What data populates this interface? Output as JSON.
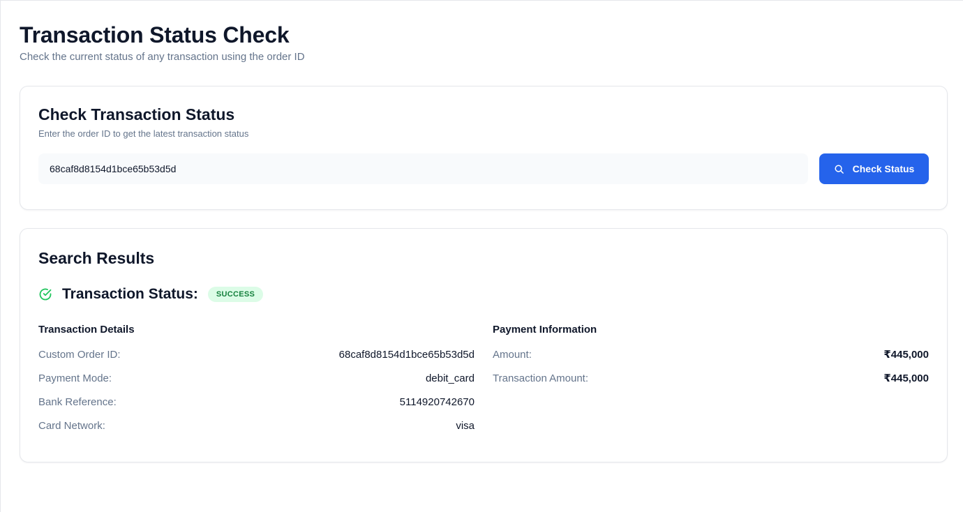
{
  "header": {
    "title": "Transaction Status Check",
    "subtitle": "Check the current status of any transaction using the order ID"
  },
  "search_card": {
    "title": "Check Transaction Status",
    "description": "Enter the order ID to get the latest transaction status",
    "order_id_value": "68caf8d8154d1bce65b53d5d",
    "button_label": "Check Status",
    "button_icon": "search-icon"
  },
  "results": {
    "title": "Search Results",
    "status_icon": "check-circle-icon",
    "status_label": "Transaction Status:",
    "status_badge": "SUCCESS",
    "transaction_details": {
      "title": "Transaction Details",
      "rows": [
        {
          "label": "Custom Order ID:",
          "value": "68caf8d8154d1bce65b53d5d"
        },
        {
          "label": "Payment Mode:",
          "value": "debit_card"
        },
        {
          "label": "Bank Reference:",
          "value": "5114920742670"
        },
        {
          "label": "Card Network:",
          "value": "visa"
        }
      ]
    },
    "payment_information": {
      "title": "Payment Information",
      "rows": [
        {
          "label": "Amount:",
          "value": "₹445,000"
        },
        {
          "label": "Transaction Amount:",
          "value": "₹445,000"
        }
      ]
    }
  },
  "colors": {
    "accent": "#2563eb",
    "success_bg": "#dcfce7",
    "success_text": "#15803d",
    "success_icon": "#22c55e"
  }
}
